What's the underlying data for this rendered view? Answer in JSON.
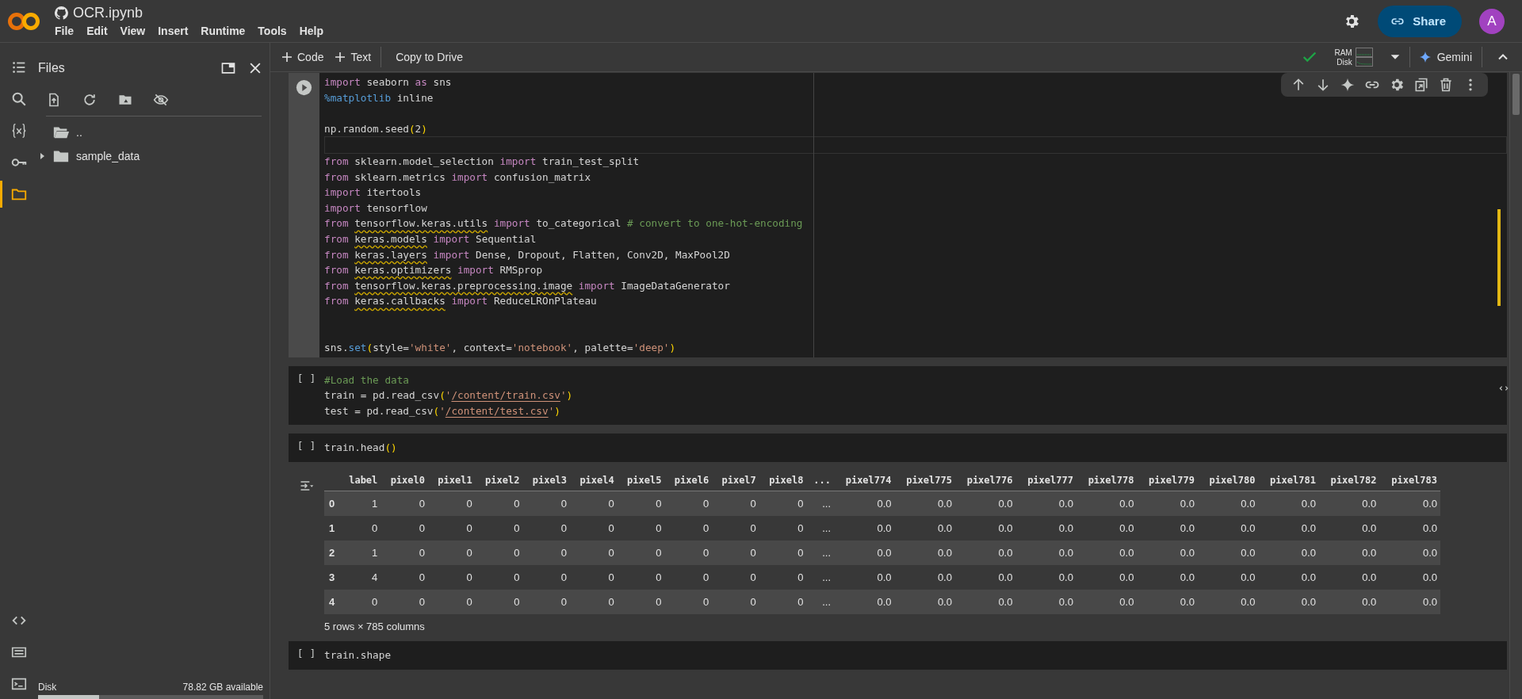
{
  "header": {
    "title": "OCR.ipynb",
    "menu": [
      "File",
      "Edit",
      "View",
      "Insert",
      "Runtime",
      "Tools",
      "Help"
    ],
    "share": "Share",
    "avatar": "A"
  },
  "sidebar": {
    "rail_top": [
      {
        "kind": "list",
        "selected": false
      },
      {
        "kind": "search",
        "selected": false
      },
      {
        "kind": "variables",
        "selected": false
      },
      {
        "kind": "key",
        "selected": false
      },
      {
        "kind": "folder",
        "selected": true
      }
    ],
    "rail_bottom": [
      {
        "kind": "code"
      },
      {
        "kind": "keyboard"
      },
      {
        "kind": "terminal"
      }
    ]
  },
  "files_panel": {
    "title": "Files",
    "tree": [
      {
        "name": "..",
        "kind": "parent"
      },
      {
        "name": "sample_data",
        "kind": "folder",
        "expanded": false
      }
    ],
    "disk": {
      "label": "Disk",
      "available": "78.82 GB available",
      "level": 0.27
    }
  },
  "toolbar": {
    "add_code": "Code",
    "add_text": "Text",
    "copy": "Copy to Drive",
    "connected": true,
    "resources": [
      "RAM",
      "Disk"
    ],
    "gemini": "Gemini"
  },
  "cells": [
    {
      "active": true,
      "lines": [
        {
          "kind": "code",
          "tokens": [
            {
              "text": "import",
              "kind": "keyword"
            },
            {
              "text": " seaborn ",
              "kind": "plain"
            },
            {
              "text": "as",
              "kind": "keyword"
            },
            {
              "text": " sns",
              "kind": "plain"
            }
          ]
        },
        {
          "kind": "code",
          "tokens": [
            {
              "text": "%matplotlib",
              "kind": "magic"
            },
            {
              "text": " inline",
              "kind": "plain"
            }
          ]
        },
        {
          "kind": "blank"
        },
        {
          "kind": "code",
          "tokens": [
            {
              "text": "np.random.seed",
              "kind": "plain"
            },
            {
              "text": "(",
              "kind": "paren"
            },
            {
              "text": "2",
              "kind": "plain"
            },
            {
              "text": ")",
              "kind": "paren"
            }
          ]
        },
        {
          "kind": "cursor"
        },
        {
          "kind": "code",
          "tokens": [
            {
              "text": "from",
              "kind": "keyword"
            },
            {
              "text": " sklearn.model_selection ",
              "kind": "plain"
            },
            {
              "text": "import",
              "kind": "keyword"
            },
            {
              "text": " train_test_split",
              "kind": "plain"
            }
          ]
        },
        {
          "kind": "code",
          "tokens": [
            {
              "text": "from",
              "kind": "keyword"
            },
            {
              "text": " sklearn.metrics ",
              "kind": "plain"
            },
            {
              "text": "import",
              "kind": "keyword"
            },
            {
              "text": " confusion_matrix",
              "kind": "plain"
            }
          ]
        },
        {
          "kind": "code",
          "tokens": [
            {
              "text": "import",
              "kind": "keyword"
            },
            {
              "text": " itertools",
              "kind": "plain"
            }
          ]
        },
        {
          "kind": "code",
          "tokens": [
            {
              "text": "import",
              "kind": "keyword"
            },
            {
              "text": " tensorflow",
              "kind": "plain"
            }
          ]
        },
        {
          "kind": "code",
          "tokens": [
            {
              "text": "from ",
              "kind": "keyword"
            },
            {
              "text": "tensorflow.keras.utils",
              "kind": "module"
            },
            {
              "text": " import",
              "kind": "keyword"
            },
            {
              "text": " to_categorical ",
              "kind": "plain"
            },
            {
              "text": "# convert to one-hot-encoding",
              "kind": "comment"
            }
          ]
        },
        {
          "kind": "code",
          "tokens": [
            {
              "text": "from ",
              "kind": "keyword"
            },
            {
              "text": "keras.models",
              "kind": "module"
            },
            {
              "text": " import",
              "kind": "keyword"
            },
            {
              "text": " Sequential",
              "kind": "plain"
            }
          ]
        },
        {
          "kind": "code",
          "tokens": [
            {
              "text": "from ",
              "kind": "keyword"
            },
            {
              "text": "keras.layers",
              "kind": "module"
            },
            {
              "text": " import",
              "kind": "keyword"
            },
            {
              "text": " Dense, Dropout, Flatten, Conv2D, MaxPool2D",
              "kind": "plain"
            }
          ]
        },
        {
          "kind": "code",
          "tokens": [
            {
              "text": "from ",
              "kind": "keyword"
            },
            {
              "text": "keras.optimizers",
              "kind": "module"
            },
            {
              "text": " import",
              "kind": "keyword"
            },
            {
              "text": " RMSprop",
              "kind": "plain"
            }
          ]
        },
        {
          "kind": "code",
          "tokens": [
            {
              "text": "from ",
              "kind": "keyword"
            },
            {
              "text": "tensorflow.keras.preprocessing.image",
              "kind": "module"
            },
            {
              "text": " import",
              "kind": "keyword"
            },
            {
              "text": " ImageDataGenerator",
              "kind": "plain"
            }
          ]
        },
        {
          "kind": "code",
          "tokens": [
            {
              "text": "from ",
              "kind": "keyword"
            },
            {
              "text": "keras.callbacks",
              "kind": "module"
            },
            {
              "text": " import",
              "kind": "keyword"
            },
            {
              "text": " ReduceLROnPlateau",
              "kind": "plain"
            }
          ]
        },
        {
          "kind": "blank"
        },
        {
          "kind": "blank"
        },
        {
          "kind": "code",
          "tokens": [
            {
              "text": "sns.",
              "kind": "plain"
            },
            {
              "text": "set",
              "kind": "function"
            },
            {
              "text": "(",
              "kind": "paren"
            },
            {
              "text": "style=",
              "kind": "plain"
            },
            {
              "text": "'white'",
              "kind": "string"
            },
            {
              "text": ", context=",
              "kind": "plain"
            },
            {
              "text": "'notebook'",
              "kind": "string"
            },
            {
              "text": ", palette=",
              "kind": "plain"
            },
            {
              "text": "'deep'",
              "kind": "string"
            },
            {
              "text": ")",
              "kind": "paren"
            }
          ]
        }
      ]
    },
    {
      "active": false,
      "run_label": "[ ]",
      "lines": [
        {
          "kind": "code",
          "tokens": [
            {
              "text": "#Load the data",
              "kind": "comment"
            }
          ]
        },
        {
          "kind": "code",
          "tokens": [
            {
              "text": "train = pd.read_csv",
              "kind": "plain"
            },
            {
              "text": "(",
              "kind": "paren"
            },
            {
              "text": "'",
              "kind": "string"
            },
            {
              "text": "/content/train.csv",
              "kind": "path"
            },
            {
              "text": "'",
              "kind": "string"
            },
            {
              "text": ")",
              "kind": "paren"
            }
          ]
        },
        {
          "kind": "code",
          "tokens": [
            {
              "text": "test = pd.read_csv",
              "kind": "plain"
            },
            {
              "text": "(",
              "kind": "paren"
            },
            {
              "text": "'",
              "kind": "string"
            },
            {
              "text": "/content/test.csv",
              "kind": "path"
            },
            {
              "text": "'",
              "kind": "string"
            },
            {
              "text": ")",
              "kind": "paren"
            }
          ]
        }
      ]
    },
    {
      "active": false,
      "run_label": "[ ]",
      "lines": [
        {
          "kind": "code",
          "tokens": [
            {
              "text": "train.head",
              "kind": "plain"
            },
            {
              "text": "()",
              "kind": "paren"
            }
          ]
        }
      ],
      "output": {
        "columns": [
          "label",
          "pixel0",
          "pixel1",
          "pixel2",
          "pixel3",
          "pixel4",
          "pixel5",
          "pixel6",
          "pixel7",
          "pixel8",
          "...",
          "pixel774",
          "pixel775",
          "pixel776",
          "pixel777",
          "pixel778",
          "pixel779",
          "pixel780",
          "pixel781",
          "pixel782",
          "pixel783"
        ],
        "rows": [
          {
            "index": "0",
            "values": [
              "1",
              "0",
              "0",
              "0",
              "0",
              "0",
              "0",
              "0",
              "0",
              "0",
              "...",
              "0.0",
              "0.0",
              "0.0",
              "0.0",
              "0.0",
              "0.0",
              "0.0",
              "0.0",
              "0.0",
              "0.0"
            ]
          },
          {
            "index": "1",
            "values": [
              "0",
              "0",
              "0",
              "0",
              "0",
              "0",
              "0",
              "0",
              "0",
              "0",
              "...",
              "0.0",
              "0.0",
              "0.0",
              "0.0",
              "0.0",
              "0.0",
              "0.0",
              "0.0",
              "0.0",
              "0.0"
            ]
          },
          {
            "index": "2",
            "values": [
              "1",
              "0",
              "0",
              "0",
              "0",
              "0",
              "0",
              "0",
              "0",
              "0",
              "...",
              "0.0",
              "0.0",
              "0.0",
              "0.0",
              "0.0",
              "0.0",
              "0.0",
              "0.0",
              "0.0",
              "0.0"
            ]
          },
          {
            "index": "3",
            "values": [
              "4",
              "0",
              "0",
              "0",
              "0",
              "0",
              "0",
              "0",
              "0",
              "0",
              "...",
              "0.0",
              "0.0",
              "0.0",
              "0.0",
              "0.0",
              "0.0",
              "0.0",
              "0.0",
              "0.0",
              "0.0"
            ]
          },
          {
            "index": "4",
            "values": [
              "0",
              "0",
              "0",
              "0",
              "0",
              "0",
              "0",
              "0",
              "0",
              "0",
              "...",
              "0.0",
              "0.0",
              "0.0",
              "0.0",
              "0.0",
              "0.0",
              "0.0",
              "0.0",
              "0.0",
              "0.0"
            ]
          }
        ],
        "summary": "5 rows × 785 columns"
      }
    },
    {
      "active": false,
      "run_label": "[ ]",
      "lines": [
        {
          "kind": "code",
          "tokens": [
            {
              "text": "train.shape",
              "kind": "plain"
            }
          ]
        }
      ]
    }
  ]
}
